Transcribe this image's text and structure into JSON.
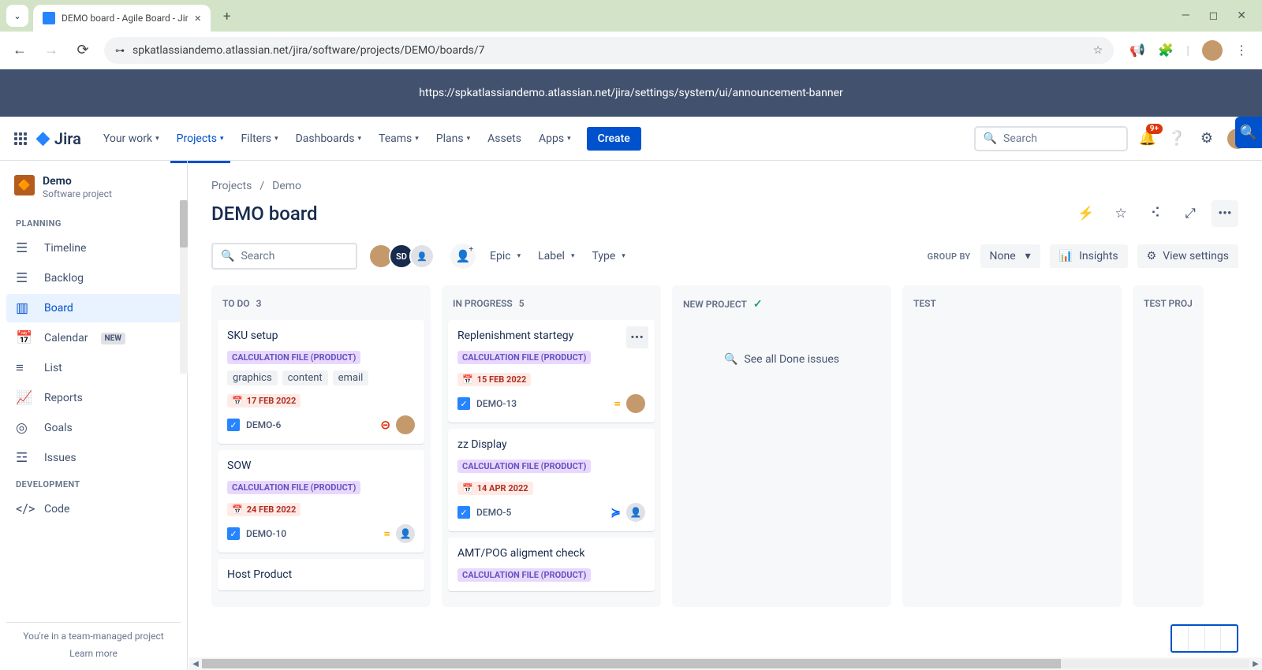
{
  "browser": {
    "tab_title": "DEMO board - Agile Board - Jir",
    "url": "spkatlassiandemo.atlassian.net/jira/software/projects/DEMO/boards/7"
  },
  "announcement": {
    "text": "https://spkatlassiandemo.atlassian.net/jira/settings/system/ui/announcement-banner"
  },
  "nav": {
    "product": "Jira",
    "items": {
      "your_work": "Your work",
      "projects": "Projects",
      "filters": "Filters",
      "dashboards": "Dashboards",
      "teams": "Teams",
      "plans": "Plans",
      "assets": "Assets",
      "apps": "Apps"
    },
    "create": "Create",
    "search_placeholder": "Search",
    "notif_count": "9+"
  },
  "sidebar": {
    "project": {
      "name": "Demo",
      "type": "Software project"
    },
    "sections": {
      "planning": "PLANNING",
      "development": "DEVELOPMENT"
    },
    "items": {
      "timeline": "Timeline",
      "backlog": "Backlog",
      "board": "Board",
      "calendar": "Calendar",
      "calendar_badge": "NEW",
      "list": "List",
      "reports": "Reports",
      "goals": "Goals",
      "issues": "Issues",
      "code": "Code"
    },
    "footer": {
      "team_managed": "You're in a team-managed project",
      "learn_more": "Learn more"
    }
  },
  "breadcrumb": {
    "projects": "Projects",
    "demo": "Demo"
  },
  "page": {
    "title": "DEMO board"
  },
  "toolbar": {
    "search_placeholder": "Search",
    "avatar_sd": "SD",
    "filters": {
      "epic": "Epic",
      "label": "Label",
      "type": "Type"
    },
    "group_by_label": "GROUP BY",
    "group_by_value": "None",
    "insights": "Insights",
    "view_settings": "View settings"
  },
  "columns": [
    {
      "name": "TO DO",
      "count": "3"
    },
    {
      "name": "IN PROGRESS",
      "count": "5"
    },
    {
      "name": "NEW PROJECT",
      "count": ""
    },
    {
      "name": "TEST",
      "count": ""
    },
    {
      "name": "TEST PROJ",
      "count": ""
    }
  ],
  "cards": {
    "c1": {
      "title": "SKU setup",
      "epic": "CALCULATION FILE (PRODUCT)",
      "tags": [
        "graphics",
        "content",
        "email"
      ],
      "due": "17 FEB 2022",
      "key": "DEMO-6"
    },
    "c2": {
      "title": "SOW",
      "epic": "CALCULATION FILE (PRODUCT)",
      "due": "24 FEB 2022",
      "key": "DEMO-10"
    },
    "c3": {
      "title": "Host Product"
    },
    "c4": {
      "title": "Replenishment startegy",
      "epic": "CALCULATION FILE (PRODUCT)",
      "due": "15 FEB 2022",
      "key": "DEMO-13"
    },
    "c5": {
      "title": "zz Display",
      "epic": "CALCULATION FILE (PRODUCT)",
      "due": "14 APR 2022",
      "key": "DEMO-5"
    },
    "c6": {
      "title": "AMT/POG aligment check",
      "epic": "CALCULATION FILE (PRODUCT)"
    }
  },
  "done_link": "See all Done issues"
}
